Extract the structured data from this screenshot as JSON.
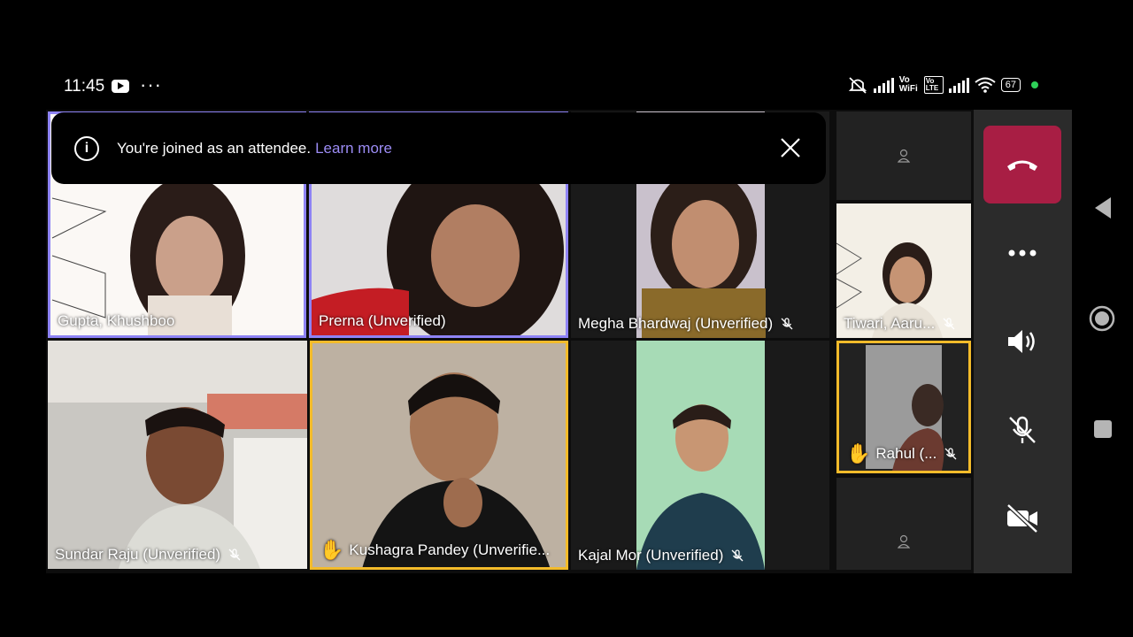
{
  "status_bar": {
    "time": "11:45",
    "more": "···",
    "battery": "67",
    "network_label": "Vo WiFi",
    "lte_label": "Vo LTE"
  },
  "banner": {
    "message": "You're joined as an attendee.",
    "link": "Learn more"
  },
  "participants": [
    {
      "name": "Gupta, Khushboo",
      "muted": false,
      "hand_raised": false
    },
    {
      "name": "Prerna (Unverified)",
      "muted": false,
      "hand_raised": false
    },
    {
      "name": "Megha Bhardwaj  (Unverified)",
      "muted": true,
      "hand_raised": false
    },
    {
      "name": "Sundar Raju (Unverified)",
      "muted": true,
      "hand_raised": false
    },
    {
      "name": "Kushagra Pandey (Unverifie...",
      "muted": false,
      "hand_raised": true
    },
    {
      "name": "Kajal Mor (Unverified)",
      "muted": true,
      "hand_raised": false
    }
  ],
  "side_participants": [
    {
      "name": "Tiwari, Aaru...",
      "muted": true,
      "hand_raised": false
    },
    {
      "name": "Rahul (...",
      "muted": true,
      "hand_raised": true
    }
  ],
  "colors": {
    "end_call": "#a81e44",
    "active_speaker_border": "#8e83f5",
    "raised_hand_border": "#f3bb2a",
    "link": "#9c8cf5"
  }
}
